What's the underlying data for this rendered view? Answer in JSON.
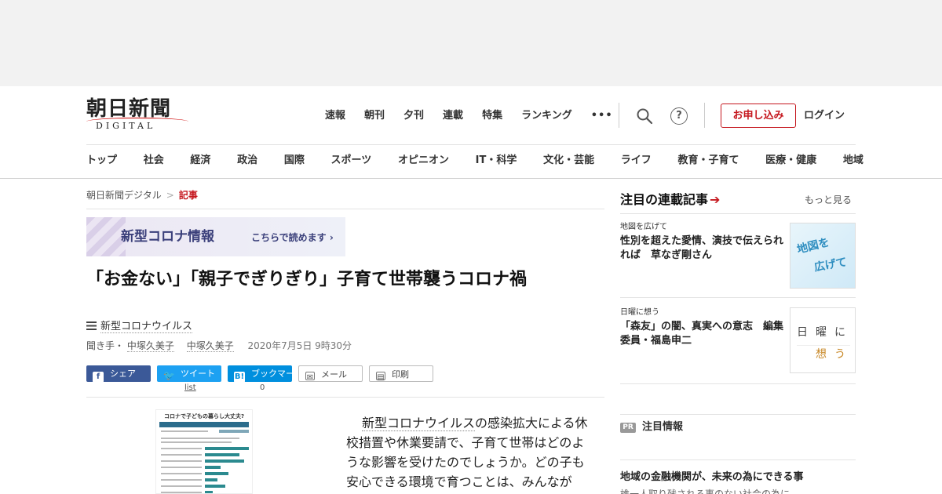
{
  "header": {
    "logo_main": "朝日新聞",
    "logo_sub": "DIGITAL",
    "top_nav": [
      "速報",
      "朝刊",
      "夕刊",
      "連載",
      "特集",
      "ランキング",
      "•••"
    ],
    "help_glyph": "?",
    "apply_label": "お申し込み",
    "login_label": "ログイン"
  },
  "category_nav": [
    "トップ",
    "社会",
    "経済",
    "政治",
    "国際",
    "スポーツ",
    "オピニオン",
    "IT・科学",
    "文化・芸能",
    "ライフ",
    "教育・子育て",
    "医療・健康",
    "地域"
  ],
  "breadcrumb": {
    "home": "朝日新聞デジタル",
    "separator": ">",
    "current": "記事"
  },
  "corona_banner": {
    "title": "新型コロナ情報",
    "link": "こちらで読めます ›"
  },
  "article": {
    "headline": "「お金ない」「親子でぎりぎり」子育て世帯襲うコロナ禍",
    "topic": "新型コロナウイルス",
    "byline_prefix": "聞き手・",
    "author_1": "中塚久美子",
    "author_2": "中塚久美子",
    "date": "2020年7月5日 9時30分",
    "body_link": "新型コロナウイルス",
    "body_text": "の感染拡大による休校措置や休業要請で、子育て世帯はどのような影響を受けたのでしょうか。どの子も安心できる環境で育つことは、みんなが"
  },
  "infographic": {
    "title": "コロナで子どもの暮らし大丈夫?"
  },
  "share": {
    "facebook": "シェア",
    "twitter": "ツイート",
    "hatena": "ブックマーク",
    "mail": "メール",
    "print": "印刷",
    "twitter_count": "list",
    "hatena_count": "0",
    "icons": {
      "facebook": "f",
      "twitter": "🐦",
      "hatena": "B!",
      "mail": "✉",
      "print": "▤"
    }
  },
  "sidebar": {
    "heading": "注目の連載記事",
    "arrow": "➔",
    "more": "もっと見る",
    "cards": [
      {
        "category": "地図を広げて",
        "title": "性別を超えた愛情、演技で伝えられれば　草なぎ剛さん",
        "thumb_line1": "地図を",
        "thumb_line2": "広げて"
      },
      {
        "category": "日曜に想う",
        "title": "「森友」の闇、真実への意志　編集委員・福島申二",
        "thumb_line1": "日曜に",
        "thumb_line2": "想う"
      }
    ],
    "pr_badge": "PR",
    "pr_label": "注目情報",
    "pr_title": "地域の金融機関が、未来の為にできる事",
    "pr_sub": "誰一人取り残される事のない社会の為に"
  }
}
